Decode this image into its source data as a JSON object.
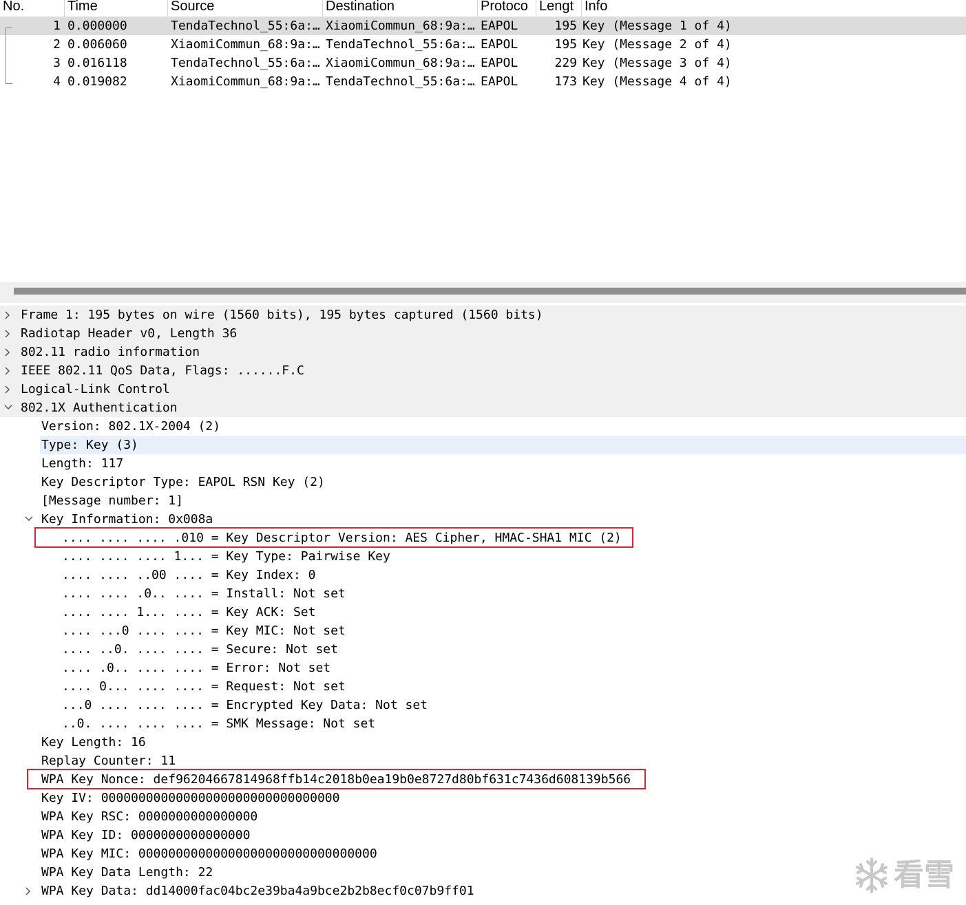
{
  "packet_list": {
    "columns": [
      "No.",
      "Time",
      "Source",
      "Destination",
      "Protoco",
      "Lengt",
      "Info"
    ],
    "rows": [
      {
        "no": "1",
        "time": "0.000000",
        "source": "TendaTechnol_55:6a:…",
        "destination": "XiaomiCommun_68:9a:…",
        "protocol": "EAPOL",
        "length": "195",
        "info": "Key (Message 1 of 4)",
        "selected": true
      },
      {
        "no": "2",
        "time": "0.006060",
        "source": "XiaomiCommun_68:9a:…",
        "destination": "TendaTechnol_55:6a:…",
        "protocol": "EAPOL",
        "length": "195",
        "info": "Key (Message 2 of 4)"
      },
      {
        "no": "3",
        "time": "0.016118",
        "source": "TendaTechnol_55:6a:…",
        "destination": "XiaomiCommun_68:9a:…",
        "protocol": "EAPOL",
        "length": "229",
        "info": "Key (Message 3 of 4)"
      },
      {
        "no": "4",
        "time": "0.019082",
        "source": "XiaomiCommun_68:9a:…",
        "destination": "TendaTechnol_55:6a:…",
        "protocol": "EAPOL",
        "length": "173",
        "info": "Key (Message 4 of 4)"
      }
    ]
  },
  "detail_tree": [
    {
      "text": "Frame 1: 195 bytes on wire (1560 bits), 195 bytes captured (1560 bits)",
      "indent": 0,
      "arrow": "collapsed",
      "shaded": true
    },
    {
      "text": "Radiotap Header v0, Length 36",
      "indent": 0,
      "arrow": "collapsed",
      "shaded": true
    },
    {
      "text": "802.11 radio information",
      "indent": 0,
      "arrow": "collapsed",
      "shaded": true
    },
    {
      "text": "IEEE 802.11 QoS Data, Flags: ......F.C",
      "indent": 0,
      "arrow": "collapsed",
      "shaded": true
    },
    {
      "text": "Logical-Link Control",
      "indent": 0,
      "arrow": "collapsed",
      "shaded": true
    },
    {
      "text": "802.1X Authentication",
      "indent": 0,
      "arrow": "expanded",
      "shaded": true
    },
    {
      "text": "Version: 802.1X-2004 (2)",
      "indent": 1
    },
    {
      "text": "Type: Key (3)",
      "indent": 1,
      "highlight": true
    },
    {
      "text": "Length: 117",
      "indent": 1
    },
    {
      "text": "Key Descriptor Type: EAPOL RSN Key (2)",
      "indent": 1
    },
    {
      "text": "[Message number: 1]",
      "indent": 1
    },
    {
      "text": "Key Information: 0x008a",
      "indent": 1,
      "arrow": "expanded"
    },
    {
      "text": ".... .... .... .010 = Key Descriptor Version: AES Cipher, HMAC-SHA1 MIC (2)",
      "indent": 2,
      "boxed": true
    },
    {
      "text": ".... .... .... 1... = Key Type: Pairwise Key",
      "indent": 2
    },
    {
      "text": ".... .... ..00 .... = Key Index: 0",
      "indent": 2
    },
    {
      "text": ".... .... .0.. .... = Install: Not set",
      "indent": 2
    },
    {
      "text": ".... .... 1... .... = Key ACK: Set",
      "indent": 2
    },
    {
      "text": ".... ...0 .... .... = Key MIC: Not set",
      "indent": 2
    },
    {
      "text": ".... ..0. .... .... = Secure: Not set",
      "indent": 2
    },
    {
      "text": ".... .0.. .... .... = Error: Not set",
      "indent": 2
    },
    {
      "text": ".... 0... .... .... = Request: Not set",
      "indent": 2
    },
    {
      "text": "...0 .... .... .... = Encrypted Key Data: Not set",
      "indent": 2
    },
    {
      "text": "..0. .... .... .... = SMK Message: Not set",
      "indent": 2
    },
    {
      "text": "Key Length: 16",
      "indent": 1
    },
    {
      "text": "Replay Counter: 11",
      "indent": 1
    },
    {
      "text": "WPA Key Nonce: def96204667814968ffb14c2018b0ea19b0e8727d80bf631c7436d608139b566",
      "indent": 1,
      "boxed": true
    },
    {
      "text": "Key IV: 00000000000000000000000000000000",
      "indent": 1
    },
    {
      "text": "WPA Key RSC: 0000000000000000",
      "indent": 1
    },
    {
      "text": "WPA Key ID: 0000000000000000",
      "indent": 1
    },
    {
      "text": "WPA Key MIC: 00000000000000000000000000000000",
      "indent": 1
    },
    {
      "text": "WPA Key Data Length: 22",
      "indent": 1
    },
    {
      "text": "WPA Key Data: dd14000fac04bc2e39ba4a9bce2b2b8ecf0c07b9ff01",
      "indent": 1,
      "arrow": "collapsed"
    }
  ],
  "watermark": {
    "text": "看雪",
    "icon": "snowflake-icon"
  },
  "colors": {
    "selected_row": "#dcdcdc",
    "shaded_row": "#f0f0f0",
    "highlight_row": "#e8f1fb",
    "annotation_box": "#e0202a"
  }
}
